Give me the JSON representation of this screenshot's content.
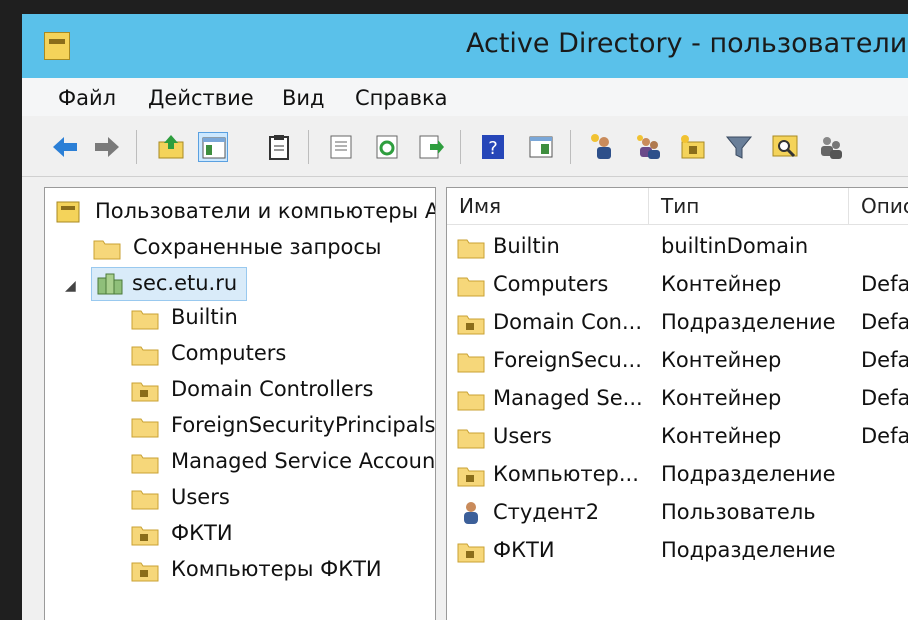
{
  "window": {
    "title": "Active Directory - пользователи"
  },
  "menu": [
    "Файл",
    "Действие",
    "Вид",
    "Справка"
  ],
  "toolbar": {
    "icons": [
      "back-icon",
      "forward-icon",
      "up-icon",
      "show-tree-icon",
      "clipboard-icon",
      "properties-icon",
      "refresh-icon",
      "export-icon",
      "help-icon",
      "action-pane-icon",
      "new-user-icon",
      "new-group-icon",
      "new-ou-icon",
      "filter-icon",
      "find-icon",
      "add-to-group-icon"
    ]
  },
  "tree": {
    "root": "Пользователи и компьютеры Active Directory",
    "saved_queries": "Сохраненные запросы",
    "domain": "sec.etu.ru",
    "children": [
      {
        "label": "Builtin",
        "kind": "folder"
      },
      {
        "label": "Computers",
        "kind": "folder"
      },
      {
        "label": "Domain Controllers",
        "kind": "ou"
      },
      {
        "label": "ForeignSecurityPrincipals",
        "kind": "folder"
      },
      {
        "label": "Managed Service Accounts",
        "kind": "folder"
      },
      {
        "label": "Users",
        "kind": "folder"
      },
      {
        "label": "ФКТИ",
        "kind": "ou"
      },
      {
        "label": "Компьютеры ФКТИ",
        "kind": "ou"
      }
    ]
  },
  "list": {
    "columns": [
      "Имя",
      "Тип",
      "Описание"
    ],
    "rows": [
      {
        "name": "Builtin",
        "type": "builtinDomain",
        "desc": "",
        "icon": "folder"
      },
      {
        "name": "Computers",
        "type": "Контейнер",
        "desc": "Default container for upgraded computer accounts",
        "icon": "folder"
      },
      {
        "name": "Domain Con...",
        "type": "Подразделение",
        "desc": "Default container for domain controllers",
        "icon": "ou"
      },
      {
        "name": "ForeignSecu...",
        "type": "Контейнер",
        "desc": "Default container for security identifiers",
        "icon": "folder"
      },
      {
        "name": "Managed Se...",
        "type": "Контейнер",
        "desc": "Default container for managed service accounts",
        "icon": "folder"
      },
      {
        "name": "Users",
        "type": "Контейнер",
        "desc": "Default container for upgraded user accounts",
        "icon": "folder"
      },
      {
        "name": "Компьютер...",
        "type": "Подразделение",
        "desc": "",
        "icon": "ou"
      },
      {
        "name": "Студент2",
        "type": "Пользователь",
        "desc": "",
        "icon": "user"
      },
      {
        "name": "ФКТИ",
        "type": "Подразделение",
        "desc": "",
        "icon": "ou"
      }
    ]
  }
}
